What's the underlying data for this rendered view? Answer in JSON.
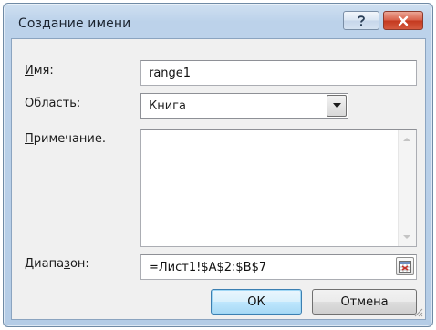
{
  "dialog": {
    "title": "Создание имени",
    "help_symbol": "?",
    "close_symbol": "✕"
  },
  "form": {
    "name": {
      "label_before": "",
      "label_underlined": "И",
      "label_after": "мя:",
      "value": "range1"
    },
    "scope": {
      "label_before": "",
      "label_underlined": "О",
      "label_after": "бласть:",
      "selected": "Книга"
    },
    "comment": {
      "label_before": "",
      "label_underlined": "П",
      "label_after": "римечание.",
      "value": ""
    },
    "range": {
      "label_before": "Диапа",
      "label_underlined": "з",
      "label_after": "он:",
      "value": "=Лист1!$A$2:$B$7"
    }
  },
  "buttons": {
    "ok": "ОК",
    "cancel": "Отмена"
  },
  "colors": {
    "accent_blue": "#3c7fb1",
    "close_red": "#c4391f",
    "chrome_blue": "#bcd2ea"
  },
  "icons": {
    "help": "question-mark-icon",
    "close": "close-icon",
    "dropdown": "triangle-down-icon",
    "range_picker": "range-selector-icon",
    "resize": "resize-grip-icon"
  }
}
